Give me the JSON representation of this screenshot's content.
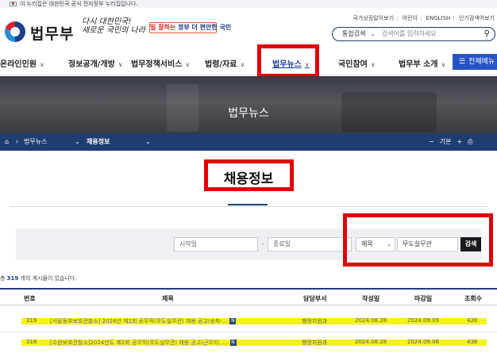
{
  "gov_banner": "이 누리집은 대한민국 공식 전자정부 누리집입니다.",
  "header": {
    "logo": "법무부",
    "slogan_hand": [
      "다시 대한민국!",
      "새로운 국민의 나라"
    ],
    "slogan_box": {
      "em": "일 잘하는",
      "rest": " 정부 더 편안한 국민"
    },
    "util_links": [
      "국가상징알아보기",
      "어린이",
      "ENGLISH",
      "인기검색어보기"
    ],
    "search": {
      "scope": "통합검색",
      "placeholder": "검색어를 입력하세요"
    }
  },
  "gnb": {
    "items": [
      "온라인민원",
      "정보공개/개방",
      "법무정책서비스",
      "법령/자료",
      "법무뉴스",
      "국민참여",
      "법무부 소개"
    ],
    "active_index": 4,
    "all_menu": "전체메뉴"
  },
  "hero": {
    "title": "법무뉴스"
  },
  "breadcrumb": {
    "level1": "법무뉴스",
    "level2": "채용정보"
  },
  "page_title": "채용정보",
  "search_panel": {
    "start_placeholder": "시작일",
    "end_placeholder": "종료일",
    "field_select": "제목",
    "keyword": "무도실무관",
    "search_button": "검색"
  },
  "total": {
    "prefix": "총 ",
    "count": "319",
    "suffix": " 개의 게시물이 있습니다."
  },
  "table": {
    "headers": [
      "번호",
      "제목",
      "담당부서",
      "작성일",
      "마감일",
      "조회수"
    ],
    "rows": [
      {
        "no": "319",
        "title": "[서울동부보호관찰소] 2024년 제1회 공무직(무도실무관) 채용 공고(송파·...",
        "dept": "행정지원과",
        "created": "2024.08.28",
        "deadline": "2024.09.09",
        "views": "426"
      },
      {
        "no": "318",
        "title": "[수원보호관찰소]2024년도 제2회 공무직(무도실무관) 채용 공고(근무지: ...",
        "dept": "행정지원과",
        "created": "2024.08.28",
        "deadline": "2024.09.06",
        "views": "436"
      }
    ],
    "badge": "N"
  },
  "colors": {
    "navy": "#1f3e70",
    "accent_blue": "#2553c6",
    "highlight_red": "#e0000a",
    "highlight_yellow": "#f6f21b"
  }
}
